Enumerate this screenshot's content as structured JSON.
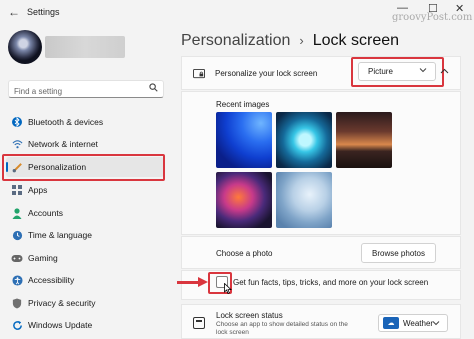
{
  "window": {
    "title": "Settings",
    "watermark": "groovyPost.com",
    "back_glyph": "←",
    "minimize_glyph": "—",
    "maximize_glyph": "☐",
    "close_glyph": "✕"
  },
  "sidebar": {
    "search_placeholder": "Find a setting",
    "items": [
      {
        "label": "Bluetooth & devices",
        "icon": "bluetooth-icon",
        "color": "#0067c0"
      },
      {
        "label": "Network & internet",
        "icon": "wifi-icon",
        "color": "#2d6fb4"
      },
      {
        "label": "Personalization",
        "icon": "brush-icon",
        "color": "#d88a2a",
        "active": true
      },
      {
        "label": "Apps",
        "icon": "apps-icon",
        "color": "#5a6b82"
      },
      {
        "label": "Accounts",
        "icon": "person-icon",
        "color": "#22a36b"
      },
      {
        "label": "Time & language",
        "icon": "globe-clock-icon",
        "color": "#2d6fb4"
      },
      {
        "label": "Gaming",
        "icon": "controller-icon",
        "color": "#666666"
      },
      {
        "label": "Accessibility",
        "icon": "accessibility-icon",
        "color": "#2d6fb4"
      },
      {
        "label": "Privacy & security",
        "icon": "shield-icon",
        "color": "#707070"
      },
      {
        "label": "Windows Update",
        "icon": "update-icon",
        "color": "#0067c0"
      }
    ]
  },
  "breadcrumb": {
    "parent": "Personalization",
    "separator": "›",
    "current": "Lock screen"
  },
  "lock_screen": {
    "personalize_label": "Personalize your lock screen",
    "personalize_value": "Picture",
    "recent_images_label": "Recent images",
    "choose_photo_label": "Choose a photo",
    "browse_button": "Browse photos",
    "fun_facts_label": "Get fun facts, tips, tricks, and more on your lock screen",
    "fun_facts_checked": false,
    "status_label": "Lock screen status",
    "status_desc_1": "Choose an app to show detailed status on the",
    "status_desc_2": "lock screen",
    "status_value": "Weather"
  },
  "colors": {
    "accent": "#0067c0",
    "highlight_red": "#d9363e"
  }
}
